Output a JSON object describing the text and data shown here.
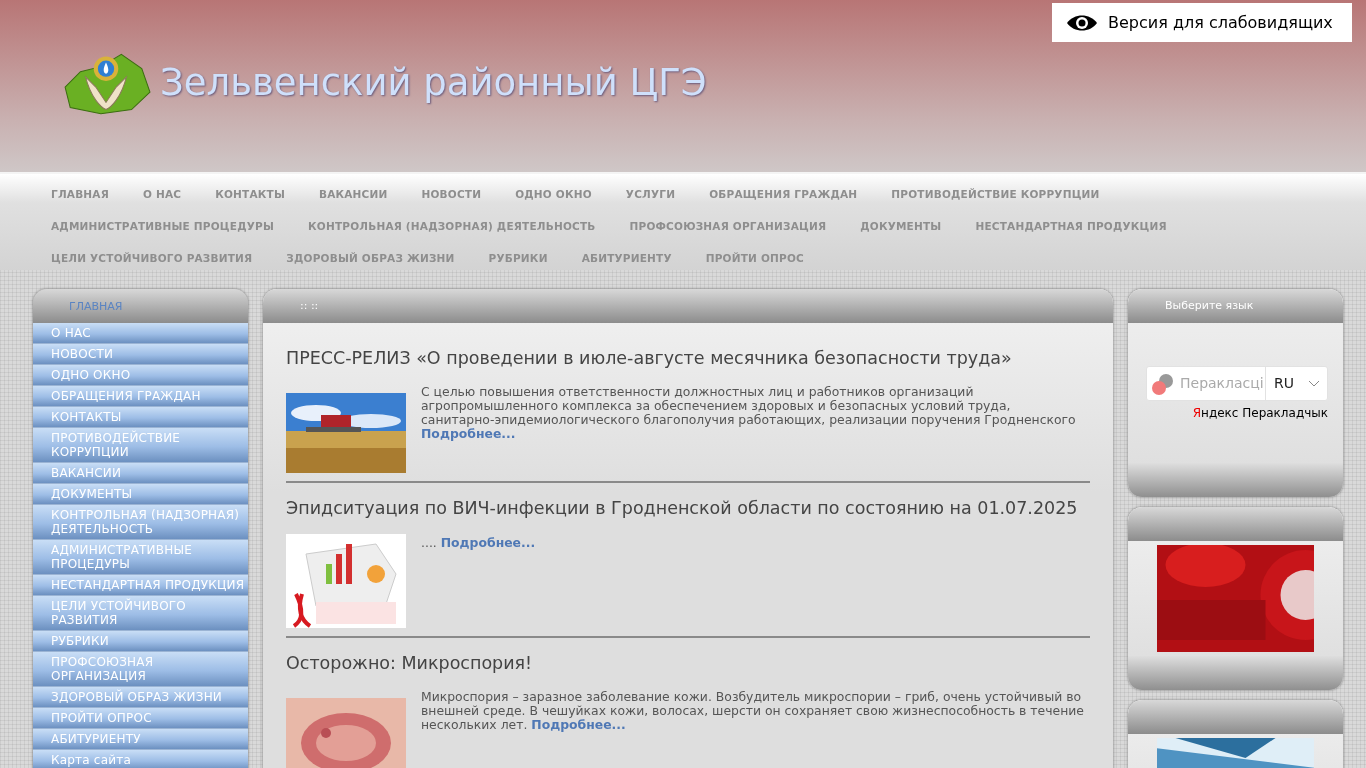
{
  "accessibility_button": {
    "label": "Версия для слабовидящих"
  },
  "site_title": "Зельвенский районный ЦГЭ",
  "nav_rows": [
    [
      "ГЛАВНАЯ",
      "О НАС",
      "КОНТАКТЫ",
      "ВАКАНСИИ",
      "НОВОСТИ",
      "ОДНО ОКНО",
      "УСЛУГИ",
      "ОБРАЩЕНИЯ ГРАЖДАН",
      "ПРОТИВОДЕЙСТВИЕ КОРРУПЦИИ"
    ],
    [
      "АДМИНИСТРАТИВНЫЕ ПРОЦЕДУРЫ",
      "КОНТРОЛЬНАЯ (НАДЗОРНАЯ) ДЕЯТЕЛЬНОСТЬ",
      "ПРОФСОЮЗНАЯ ОРГАНИЗАЦИЯ",
      "ДОКУМЕНТЫ",
      "НЕСТАНДАРТНАЯ ПРОДУКЦИЯ"
    ],
    [
      "ЦЕЛИ УСТОЙЧИВОГО РАЗВИТИЯ",
      "ЗДОРОВЫЙ ОБРАЗ ЖИЗНИ",
      "РУБРИКИ",
      "АБИТУРИЕНТУ",
      "ПРОЙТИ ОПРОС"
    ]
  ],
  "sidebar": {
    "title": "ГЛАВНАЯ",
    "items": [
      "О НАС",
      "НОВОСТИ",
      "ОДНО ОКНО",
      "ОБРАЩЕНИЯ ГРАЖДАН",
      "КОНТАКТЫ",
      "ПРОТИВОДЕЙСТВИЕ КОРРУПЦИИ",
      "ВАКАНСИИ",
      "ДОКУМЕНТЫ",
      "КОНТРОЛЬНАЯ (НАДЗОРНАЯ) ДЕЯТЕЛЬНОСТЬ",
      "АДМИНИСТРАТИВНЫЕ ПРОЦЕДУРЫ",
      "НЕСТАНДАРТНАЯ ПРОДУКЦИЯ",
      "ЦЕЛИ УСТОЙЧИВОГО РАЗВИТИЯ",
      "РУБРИКИ",
      "ПРОФСОЮЗНАЯ ОРГАНИЗАЦИЯ",
      "ЗДОРОВЫЙ ОБРАЗ ЖИЗНИ",
      "ПРОЙТИ ОПРОС",
      "АБИТУРИЕНТУ",
      "Карта сайта"
    ]
  },
  "content": {
    "header": ":: ::",
    "articles": [
      {
        "title": "ПРЕСС-РЕЛИЗ «О проведении в июле-августе месячника безопасности труда»",
        "summary": "С целью повышения ответственности должностных лиц и работников организаций агропромышленного комплекса за обеспечением здоровых и безопасных условий труда, санитарно-эпидемиологического благополучия работающих, реализации поручения Гродненского",
        "more": "Подробнее..."
      },
      {
        "title": "Эпидситуация по ВИЧ-инфекции в Гродненской области по состоянию на 01.07.2025",
        "summary": "....",
        "more": "Подробнее..."
      },
      {
        "title": "Осторожно: Микроспория!",
        "summary": "Микроспория – заразное заболевание кожи. Возбудитель микроспории – гриб, очень устойчивый во внешней среде. В чешуйках кожи, волосах, шерсти он сохраняет свою жизнеспособность в течение нескольких лет.",
        "more": "Подробнее..."
      }
    ]
  },
  "language_box": {
    "title": "Выберите язык",
    "translate_button": "Перакласці",
    "language": "RU",
    "provider_mark": "Я",
    "provider_rest": "ндекс Перакладчык"
  }
}
